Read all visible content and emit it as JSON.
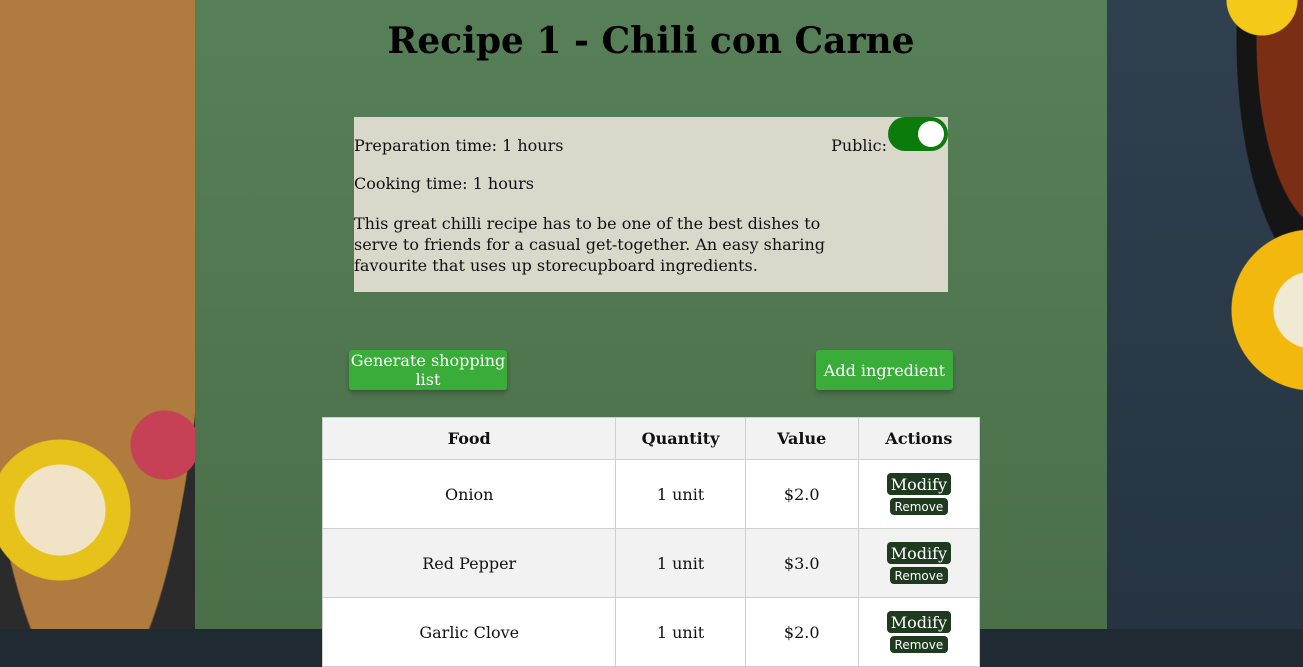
{
  "page": {
    "title": "Recipe 1 - Chili con Carne"
  },
  "recipe": {
    "preparation": "Preparation time: 1 hours",
    "cooking": "Cooking time: 1 hours",
    "description": "This great chilli recipe has to be one of the best dishes to serve to friends for a casual get-together. An easy sharing favourite that uses up storecupboard ingredients.",
    "public_label": "Public:",
    "public_on": true
  },
  "actions": {
    "shopping_label": "Generate shopping list",
    "add_label": "Add ingredient"
  },
  "table": {
    "headers": [
      "Food",
      "Quantity",
      "Value",
      "Actions"
    ],
    "rows": [
      {
        "food": "Onion",
        "quantity": "1 unit",
        "value": "$2.0",
        "modify": "Modify",
        "remove": "Remove"
      },
      {
        "food": "Red Pepper",
        "quantity": "1 unit",
        "value": "$3.0",
        "modify": "Modify",
        "remove": "Remove"
      },
      {
        "food": "Garlic Clove",
        "quantity": "1 unit",
        "value": "$2.0",
        "modify": "Modify",
        "remove": "Remove"
      }
    ]
  },
  "colors": {
    "main_panel": "#578058",
    "button_green": "#3aac3a",
    "toggle_on": "#0b7c0b",
    "action_button": "#1f3a1f"
  }
}
